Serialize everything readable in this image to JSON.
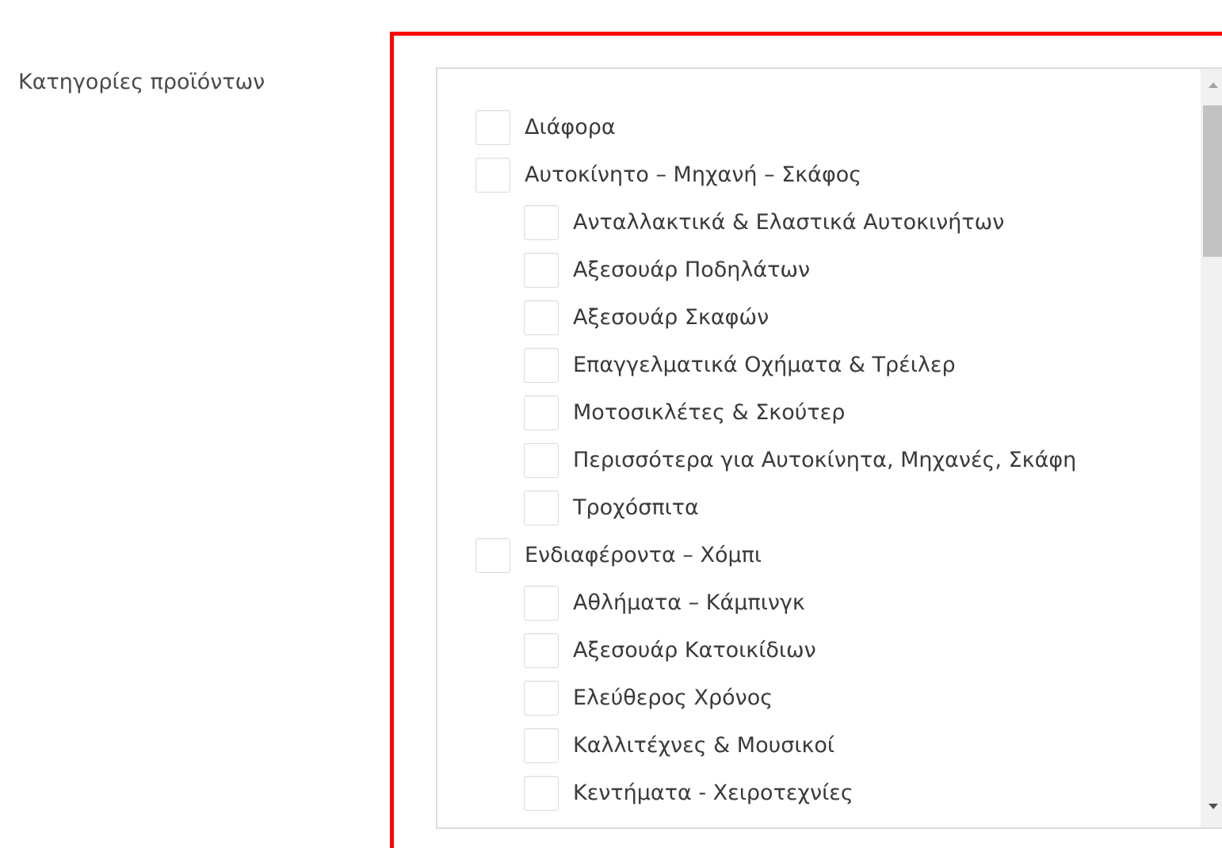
{
  "field": {
    "label": "Κατηγορίες προϊόντων"
  },
  "categories": [
    {
      "label": "Διάφορα",
      "level": 0,
      "checked": false
    },
    {
      "label": "Αυτοκίνητο – Μηχανή – Σκάφος",
      "level": 0,
      "checked": false
    },
    {
      "label": "Ανταλλακτικά & Ελαστικά Αυτοκινήτων",
      "level": 1,
      "checked": false
    },
    {
      "label": "Αξεσουάρ Ποδηλάτων",
      "level": 1,
      "checked": false
    },
    {
      "label": "Αξεσουάρ Σκαφών",
      "level": 1,
      "checked": false
    },
    {
      "label": "Επαγγελματικά Οχήματα & Τρέιλερ",
      "level": 1,
      "checked": false
    },
    {
      "label": "Μοτοσικλέτες & Σκούτερ",
      "level": 1,
      "checked": false
    },
    {
      "label": "Περισσότερα για Αυτοκίνητα, Μηχανές, Σκάφη",
      "level": 1,
      "checked": false
    },
    {
      "label": "Τροχόσπιτα",
      "level": 1,
      "checked": false
    },
    {
      "label": "Ενδιαφέροντα – Χόμπι",
      "level": 0,
      "checked": false
    },
    {
      "label": "Αθλήματα – Κάμπινγκ",
      "level": 1,
      "checked": false
    },
    {
      "label": "Αξεσουάρ Κατοικίδιων",
      "level": 1,
      "checked": false
    },
    {
      "label": "Ελεύθερος Χρόνος",
      "level": 1,
      "checked": false
    },
    {
      "label": "Καλλιτέχνες & Μουσικοί",
      "level": 1,
      "checked": false
    },
    {
      "label": "Κεντήματα - Χειροτεχνίες",
      "level": 1,
      "checked": false
    }
  ],
  "colors": {
    "highlight_border": "#ff0000",
    "list_border": "#dddddd",
    "text": "#3a3a3a",
    "scroll_thumb": "#c1c1c1"
  }
}
